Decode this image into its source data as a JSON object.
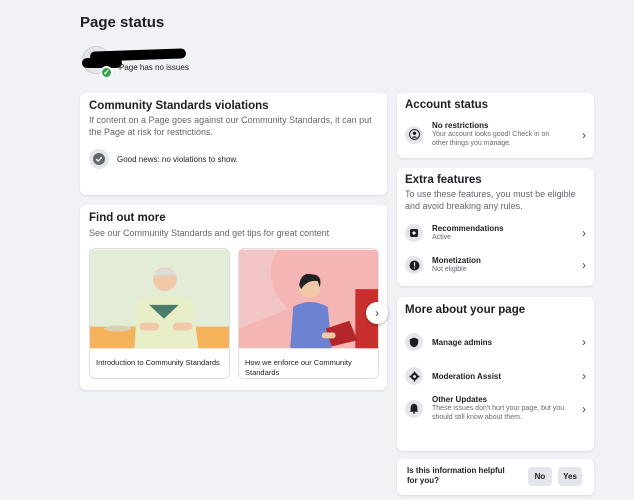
{
  "page": {
    "title": "Page status",
    "header_status": "Page has no issues"
  },
  "violations": {
    "title": "Community Standards violations",
    "subtitle": "If content on a Page goes against our Community Standards, it can put the Page at risk for restrictions.",
    "good_news": "Good news: no violations to show."
  },
  "find_out": {
    "title": "Find out more",
    "subtitle": "See our Community Standards and get tips for great content",
    "tiles": [
      {
        "label": "Introduction to Community Standards"
      },
      {
        "label": "How we enforce our Community Standards"
      }
    ]
  },
  "account_status": {
    "title": "Account status",
    "item": {
      "label": "No restrictions",
      "desc": "Your account looks good! Check in on other things you manage."
    }
  },
  "extra_features": {
    "title": "Extra features",
    "subtitle": "To use these features, you must be eligible and avoid breaking any rules.",
    "items": [
      {
        "label": "Recommendations",
        "desc": "Active"
      },
      {
        "label": "Monetization",
        "desc": "Not eligible"
      }
    ]
  },
  "more_about": {
    "title": "More about your page",
    "items": [
      {
        "label": "Manage admins",
        "desc": ""
      },
      {
        "label": "Moderation Assist",
        "desc": ""
      },
      {
        "label": "Other Updates",
        "desc": "These issues don't hurt your page, but you should still know about them."
      }
    ]
  },
  "feedback": {
    "question": "Is this information helpful for you?",
    "no": "No",
    "yes": "Yes"
  },
  "icons": {
    "chevron": "chevron-right-icon",
    "check": "checkmark-icon",
    "person": "person-icon",
    "shield": "shield-icon",
    "bell": "bell-icon"
  },
  "colors": {
    "success": "#31a24c",
    "background": "#f0f2f5"
  }
}
